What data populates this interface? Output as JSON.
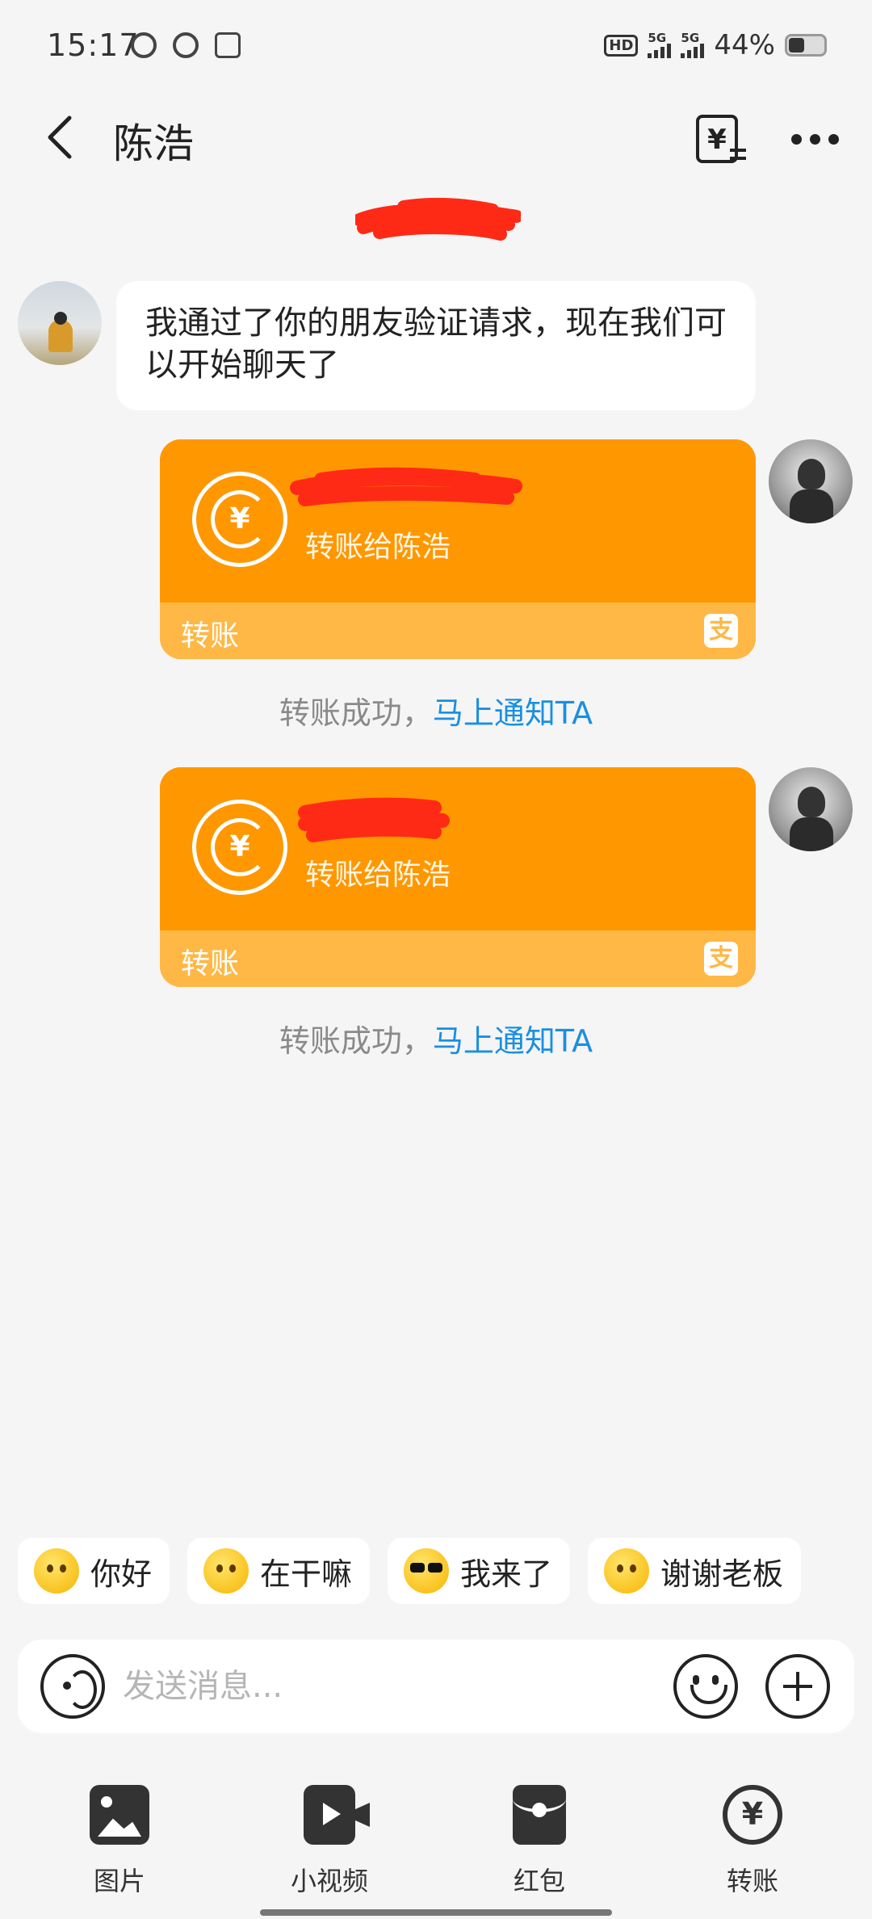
{
  "status_bar": {
    "time": "15:17",
    "hd_label": "HD",
    "network_1": "5G",
    "network_2": "5G",
    "battery_text": "44%",
    "battery_level": 0.44
  },
  "header": {
    "title": "陈浩"
  },
  "messages": {
    "greeting": "我通过了你的朋友验证请求，现在我们可以开始聊天了",
    "transfers": [
      {
        "subtitle": "转账给陈浩",
        "label": "转账",
        "alipay_glyph": "支",
        "yuan_glyph": "¥",
        "status": "转账成功，",
        "notify_link": "马上通知TA"
      },
      {
        "subtitle": "转账给陈浩",
        "label": "转账",
        "alipay_glyph": "支",
        "yuan_glyph": "¥",
        "status": "转账成功，",
        "notify_link": "马上通知TA"
      }
    ]
  },
  "quick_replies": [
    {
      "label": "你好",
      "icon": "wink-emoji-icon"
    },
    {
      "label": "在干嘛",
      "icon": "surprised-emoji-icon"
    },
    {
      "label": "我来了",
      "icon": "sunglasses-emoji-icon"
    },
    {
      "label": "谢谢老板",
      "icon": "thanks-emoji-icon"
    }
  ],
  "input": {
    "placeholder": "发送消息..."
  },
  "toolbar": {
    "items": [
      {
        "label": "图片",
        "icon": "picture-icon"
      },
      {
        "label": "小视频",
        "icon": "video-icon"
      },
      {
        "label": "红包",
        "icon": "red-packet-icon"
      },
      {
        "label": "转账",
        "icon": "transfer-icon"
      }
    ],
    "transfer_glyph": "¥"
  },
  "colors": {
    "transfer_card": "#ff9700",
    "transfer_card_footer": "#ffb845",
    "link": "#1a8fe0",
    "background": "#f5f5f5"
  }
}
